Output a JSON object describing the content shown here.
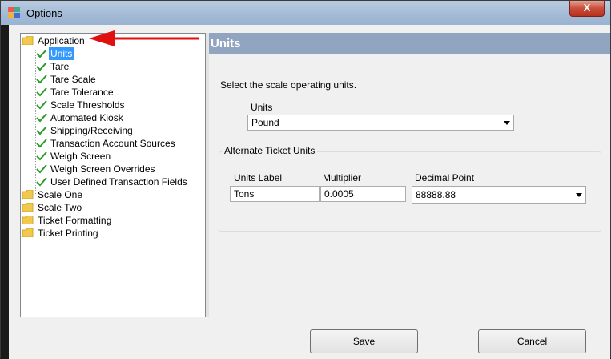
{
  "window": {
    "title": "Options",
    "close_glyph": "X"
  },
  "tree": {
    "items": [
      {
        "label": "Application",
        "kind": "folder"
      },
      {
        "label": "Units",
        "kind": "check",
        "selected": true
      },
      {
        "label": "Tare",
        "kind": "check"
      },
      {
        "label": "Tare Scale",
        "kind": "check"
      },
      {
        "label": "Tare Tolerance",
        "kind": "check"
      },
      {
        "label": "Scale Thresholds",
        "kind": "check"
      },
      {
        "label": "Automated Kiosk",
        "kind": "check"
      },
      {
        "label": "Shipping/Receiving",
        "kind": "check"
      },
      {
        "label": "Transaction Account Sources",
        "kind": "check"
      },
      {
        "label": "Weigh Screen",
        "kind": "check"
      },
      {
        "label": "Weigh Screen Overrides",
        "kind": "check"
      },
      {
        "label": "User Defined Transaction Fields",
        "kind": "check"
      },
      {
        "label": "Scale One",
        "kind": "folder"
      },
      {
        "label": "Scale Two",
        "kind": "folder"
      },
      {
        "label": "Ticket Formatting",
        "kind": "folder"
      },
      {
        "label": "Ticket Printing",
        "kind": "folder"
      }
    ]
  },
  "panel": {
    "header": "Units",
    "instruction": "Select the scale operating units.",
    "units_label": "Units",
    "units_value": "Pound",
    "alt_group_title": "Alternate Ticket Units",
    "units_label_label": "Units Label",
    "units_label_value": "Tons",
    "multiplier_label": "Multiplier",
    "multiplier_value": "0.0005",
    "decimal_point_label": "Decimal Point",
    "decimal_point_value": "88888.88"
  },
  "buttons": {
    "save": "Save",
    "cancel": "Cancel"
  },
  "colors": {
    "panel_header": "#91a5c0",
    "selection": "#3399ff",
    "annotation_arrow": "#e01010",
    "check": "#2a9a2a",
    "folder": "#f2c94c"
  }
}
